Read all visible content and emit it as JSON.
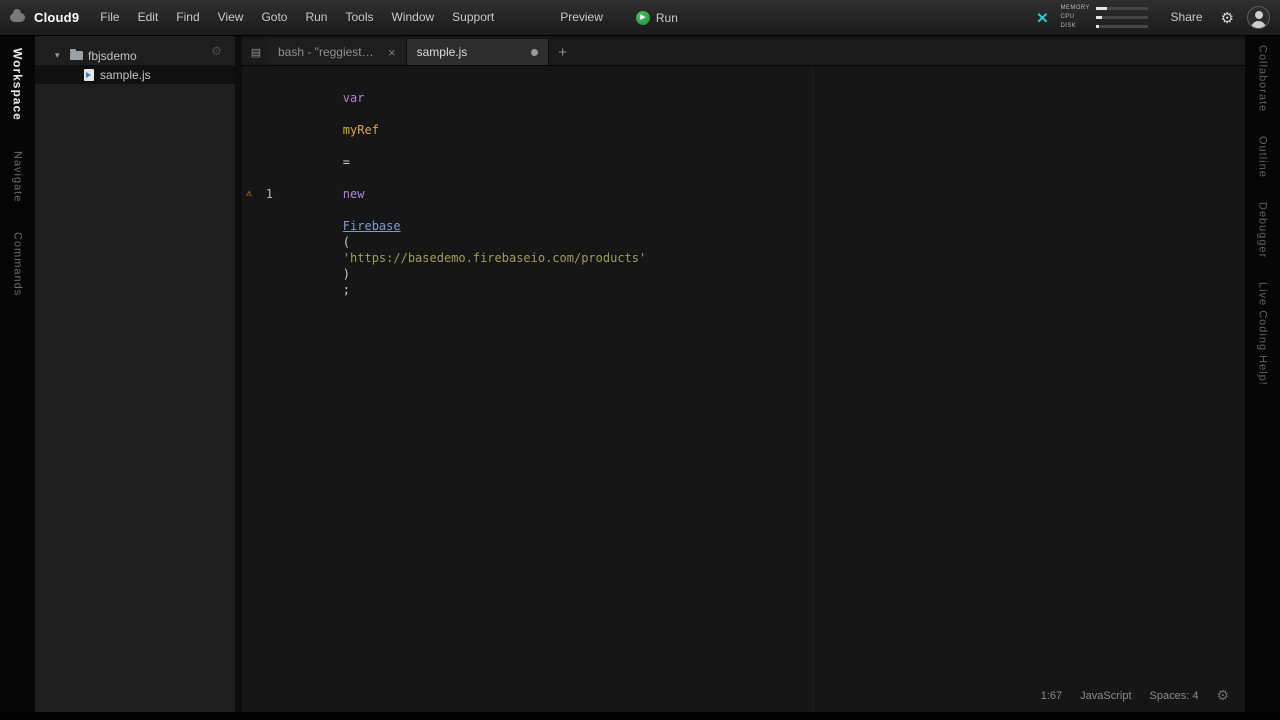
{
  "menubar": {
    "logo": "Cloud9",
    "items": [
      "File",
      "Edit",
      "Find",
      "View",
      "Goto",
      "Run",
      "Tools",
      "Window",
      "Support"
    ],
    "preview_label": "Preview",
    "run_label": "Run",
    "share_label": "Share",
    "stats": [
      {
        "label": "MEMORY"
      },
      {
        "label": "CPU"
      },
      {
        "label": "DISK"
      }
    ]
  },
  "left_rail": {
    "tabs": [
      {
        "label": "Workspace"
      },
      {
        "label": "Navigate"
      },
      {
        "label": "Commands"
      }
    ]
  },
  "right_rail": {
    "tabs": [
      {
        "label": "Collaborate"
      },
      {
        "label": "Outline"
      },
      {
        "label": "Debugger"
      },
      {
        "label": "Live Coding Help!"
      }
    ]
  },
  "tree": {
    "folder_label": "fbjsdemo",
    "file_label": "sample.js"
  },
  "editor": {
    "tabs": [
      {
        "label": "bash - \"reggiesteppa\""
      },
      {
        "label": "sample.js"
      }
    ],
    "gutter_line": "1",
    "tokens": [
      {
        "text": "var"
      },
      {
        "text": " "
      },
      {
        "text": "myRef"
      },
      {
        "text": " "
      },
      {
        "text": "="
      },
      {
        "text": " "
      },
      {
        "text": "new"
      },
      {
        "text": " "
      },
      {
        "text": "Firebase"
      },
      {
        "text": "("
      },
      {
        "text": "'https://basedemo.firebaseio.com/products'"
      },
      {
        "text": ")"
      },
      {
        "text": ";"
      }
    ]
  },
  "statusbar": {
    "cursor": "1:67",
    "language": "JavaScript",
    "spaces": "Spaces: 4"
  },
  "icons": {
    "play": "▶",
    "gear": "⚙",
    "warning": "⚠",
    "close": "×",
    "plus": "+",
    "tab_list": "▤",
    "disclosure_open": "▾",
    "collab": "✕"
  },
  "colors": {
    "run_green": "#2e9e44",
    "collab_cyan": "#38c6d4",
    "warning_orange": "#e8a33d",
    "keyword_purple": "#ac85d4",
    "string_olive": "#9b9e57",
    "function_blue": "#7d9dc9",
    "variable_orange": "#dfa356"
  }
}
